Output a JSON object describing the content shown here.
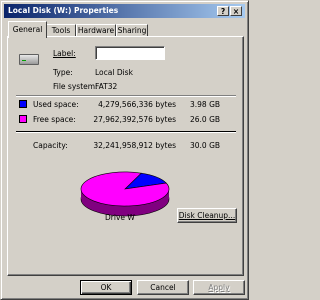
{
  "window": {
    "title": "Local Disk (W:) Properties",
    "help_label": "?",
    "close_label": "×"
  },
  "tabs": [
    {
      "label": "General",
      "active": true
    },
    {
      "label": "Tools",
      "active": false
    },
    {
      "label": "Hardware",
      "active": false
    },
    {
      "label": "Sharing",
      "active": false
    }
  ],
  "general": {
    "label_caption": "Label:",
    "label_value": "",
    "type_caption": "Type:",
    "type_value": "Local Disk",
    "fs_caption": "File system:",
    "fs_value": "FAT32",
    "used": {
      "caption": "Used space:",
      "bytes": "4,279,566,336 bytes",
      "size": "3.98 GB",
      "color": "#0000ff"
    },
    "free": {
      "caption": "Free space:",
      "bytes": "27,962,392,576 bytes",
      "size": "26.0 GB",
      "color": "#ff00ff"
    },
    "capacity": {
      "caption": "Capacity:",
      "bytes": "32,241,958,912 bytes",
      "size": "30.0 GB"
    },
    "drive_name": "Drive W",
    "cleanup_label": "Disk Cleanup..."
  },
  "chart_data": {
    "type": "pie",
    "slices": [
      {
        "name": "Used space",
        "value": 3.98,
        "color": "#0000ff"
      },
      {
        "name": "Free space",
        "value": 26.0,
        "color": "#ff00ff"
      }
    ],
    "title": "Drive W"
  },
  "footer": {
    "ok_label": "OK",
    "cancel_label": "Cancel",
    "apply_label": "Apply"
  }
}
